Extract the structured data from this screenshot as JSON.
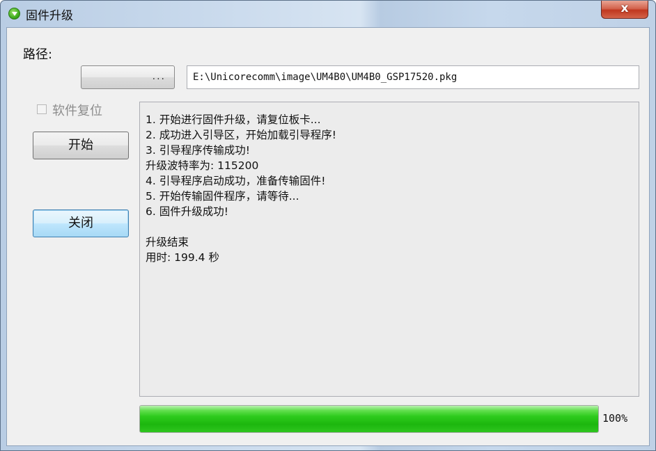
{
  "window": {
    "title": "固件升级",
    "close_glyph": "x"
  },
  "path": {
    "label": "路径:",
    "browse_label": "...",
    "value": "E:\\Unicorecomm\\image\\UM4B0\\UM4B0_GSP17520.pkg"
  },
  "options": {
    "soft_reset_label": "软件复位",
    "soft_reset_checked": false
  },
  "buttons": {
    "start_label": "开始",
    "close_label": "关闭"
  },
  "log": {
    "lines": [
      "1. 开始进行固件升级，请复位板卡...",
      "2. 成功进入引导区，开始加载引导程序!",
      "3. 引导程序传输成功!",
      "升级波特率为: 115200",
      "4. 引导程序启动成功，准备传输固件!",
      "5. 开始传输固件程序，请等待...",
      "6. 固件升级成功!",
      "",
      "升级结束",
      "用时: 199.4 秒"
    ]
  },
  "progress": {
    "value": 1.0,
    "text": "100%",
    "color": "#22c414"
  }
}
